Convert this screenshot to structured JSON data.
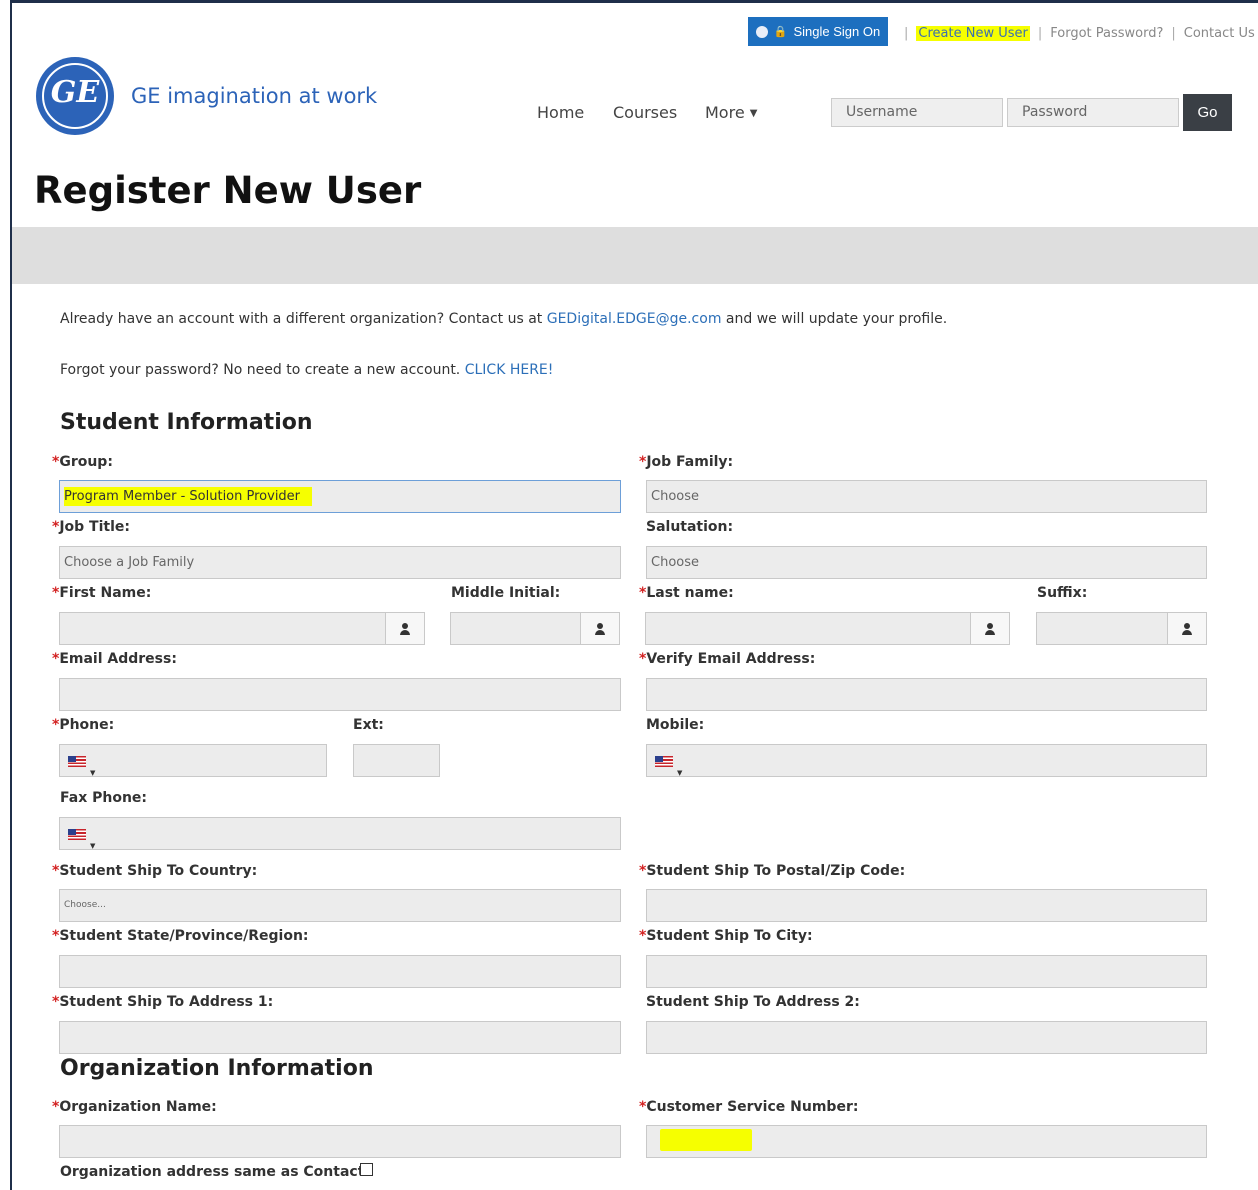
{
  "topbar": {
    "sso_label": "Single Sign On",
    "links": [
      "Create New User",
      "Forgot Password?",
      "Contact Us"
    ]
  },
  "brand": {
    "tagline": "GE imagination at work",
    "logo_text": "GE"
  },
  "nav": {
    "items": [
      "Home",
      "Courses",
      "More"
    ],
    "more_caret": "▼",
    "username_placeholder": "Username",
    "password_placeholder": "Password",
    "go_label": "Go"
  },
  "page": {
    "title": "Register New User"
  },
  "info": {
    "line1_before": "Already have an account with a different organization? Contact us at ",
    "line1_link": "GEDigital.EDGE@ge.com",
    "line1_after": " and we will update your profile.",
    "line2_before": "Forgot your password? No need to create a new account. ",
    "line2_link": "CLICK HERE!"
  },
  "student": {
    "title": "Student Information",
    "required_marker": "*",
    "group_label": "Group:",
    "group_value": "Program Member - Solution Provider",
    "job_family_label": "Job Family:",
    "job_family_value": "Choose",
    "job_title_label": "Job Title:",
    "job_title_value": "Choose a Job Family",
    "salutation_label": "Salutation:",
    "salutation_value": "Choose",
    "first_name_label": "First Name:",
    "middle_initial_label": "Middle Initial:",
    "last_name_label": "Last name:",
    "suffix_label": "Suffix:",
    "email_label": "Email Address:",
    "verify_email_label": "Verify Email Address:",
    "phone_label": "Phone:",
    "ext_label": "Ext:",
    "mobile_label": "Mobile:",
    "fax_label": "Fax Phone:",
    "country_label": "Student Ship To Country:",
    "country_value": "Choose...",
    "postal_label": "Student Ship To Postal/Zip Code:",
    "state_label": "Student State/Province/Region:",
    "city_label": "Student Ship To City:",
    "address1_label": "Student Ship To Address 1:",
    "address2_label": "Student Ship To Address 2:"
  },
  "organization": {
    "title": "Organization Information",
    "name_label": "Organization Name:",
    "csn_label": "Customer Service Number:",
    "same_address_label": "Organization address same as Contact:"
  },
  "colors": {
    "accent": "#2c63b8",
    "required": "#d32222",
    "highlight": "#f6ff00",
    "sso": "#1d6fbf"
  },
  "icons": [
    "globe-icon",
    "lock-icon",
    "person-icon",
    "us-flag-icon",
    "chevron-down-icon"
  ]
}
